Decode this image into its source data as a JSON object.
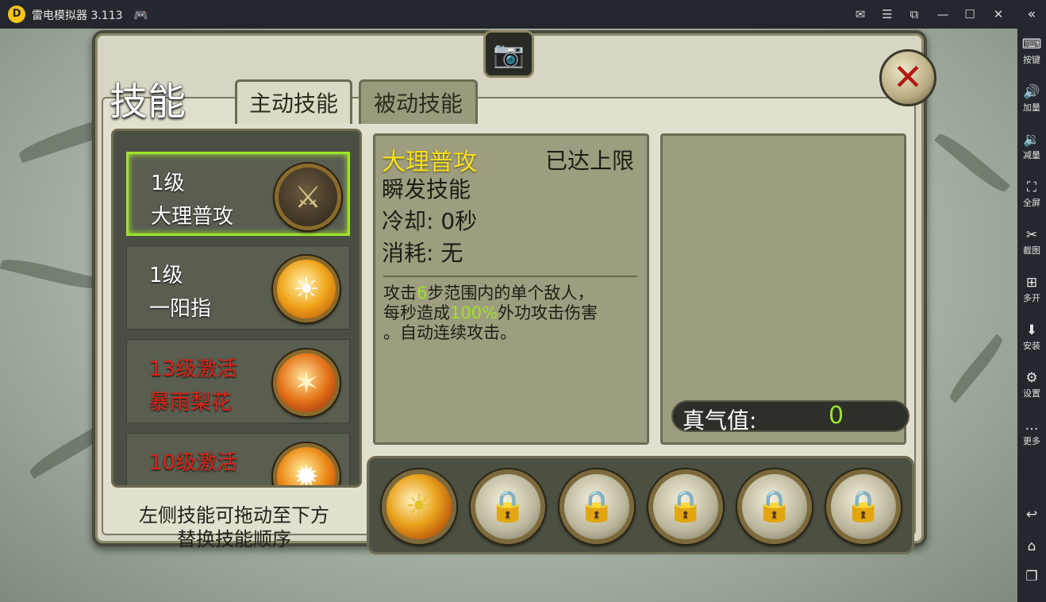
{
  "window": {
    "title": "雷电模拟器 3.113",
    "logo_glyph": "D",
    "icons": [
      "gamepad-icon",
      "mail-icon",
      "menu-icon",
      "restore-mini-icon",
      "minimize-icon",
      "maximize-icon",
      "close-icon",
      "collapse-icon"
    ]
  },
  "sidebar": {
    "items": [
      {
        "icon": "⌨",
        "label": "按键"
      },
      {
        "icon": "🔊",
        "label": "加量"
      },
      {
        "icon": "🔉",
        "label": "减量"
      },
      {
        "icon": "⛶",
        "label": "全屏"
      },
      {
        "icon": "✂",
        "label": "截图"
      },
      {
        "icon": "⊞",
        "label": "多开"
      },
      {
        "icon": "⬇",
        "label": "安装"
      },
      {
        "icon": "⚙",
        "label": "设置"
      },
      {
        "icon": "…",
        "label": "更多"
      }
    ],
    "nav": {
      "back": "↩",
      "home": "⌂",
      "recent": "❐"
    }
  },
  "game": {
    "page_title": "技能",
    "tabs": [
      {
        "label": "主动技能",
        "active": true
      },
      {
        "label": "被动技能",
        "active": false
      }
    ],
    "skills": [
      {
        "level": "1级",
        "name": "大理普攻",
        "selected": true,
        "locked": false,
        "icon": "⚔"
      },
      {
        "level": "1级",
        "name": "一阳指",
        "selected": false,
        "locked": false,
        "icon": "☀"
      },
      {
        "level": "13级激活",
        "name": "暴雨梨花",
        "selected": false,
        "locked": true,
        "icon": "✶"
      },
      {
        "level": "10级激活",
        "name": "",
        "selected": false,
        "locked": true,
        "icon": "✹"
      }
    ],
    "hint_line1": "左侧技能可拖动至下方",
    "hint_line2": "替换技能顺序",
    "detail": {
      "name": "大理普攻",
      "limit": "已达上限",
      "type": "瞬发技能",
      "cooldown_label": "冷却:",
      "cooldown_value": "0秒",
      "cost_label": "消耗:",
      "cost_value": "无",
      "desc_a": "攻击",
      "desc_range": "6",
      "desc_b": "步范围内的单个敌人，",
      "desc_c": "每秒造成",
      "desc_pct": "100%",
      "desc_d": "外功攻击伤害",
      "desc_e": "。自动连续攻击。"
    },
    "qi": {
      "label": "真气值:",
      "value": "0"
    },
    "slots": [
      {
        "state": "filled",
        "icon": "☀"
      },
      {
        "state": "locked",
        "icon": "🔒"
      },
      {
        "state": "locked",
        "icon": "🔒"
      },
      {
        "state": "locked",
        "icon": "🔒"
      },
      {
        "state": "locked",
        "icon": "🔒"
      },
      {
        "state": "locked",
        "icon": "🔒"
      }
    ],
    "colors": {
      "highlight": "#9be32a",
      "locked_text": "#e02418",
      "skill_name": "#f8e11c"
    }
  }
}
